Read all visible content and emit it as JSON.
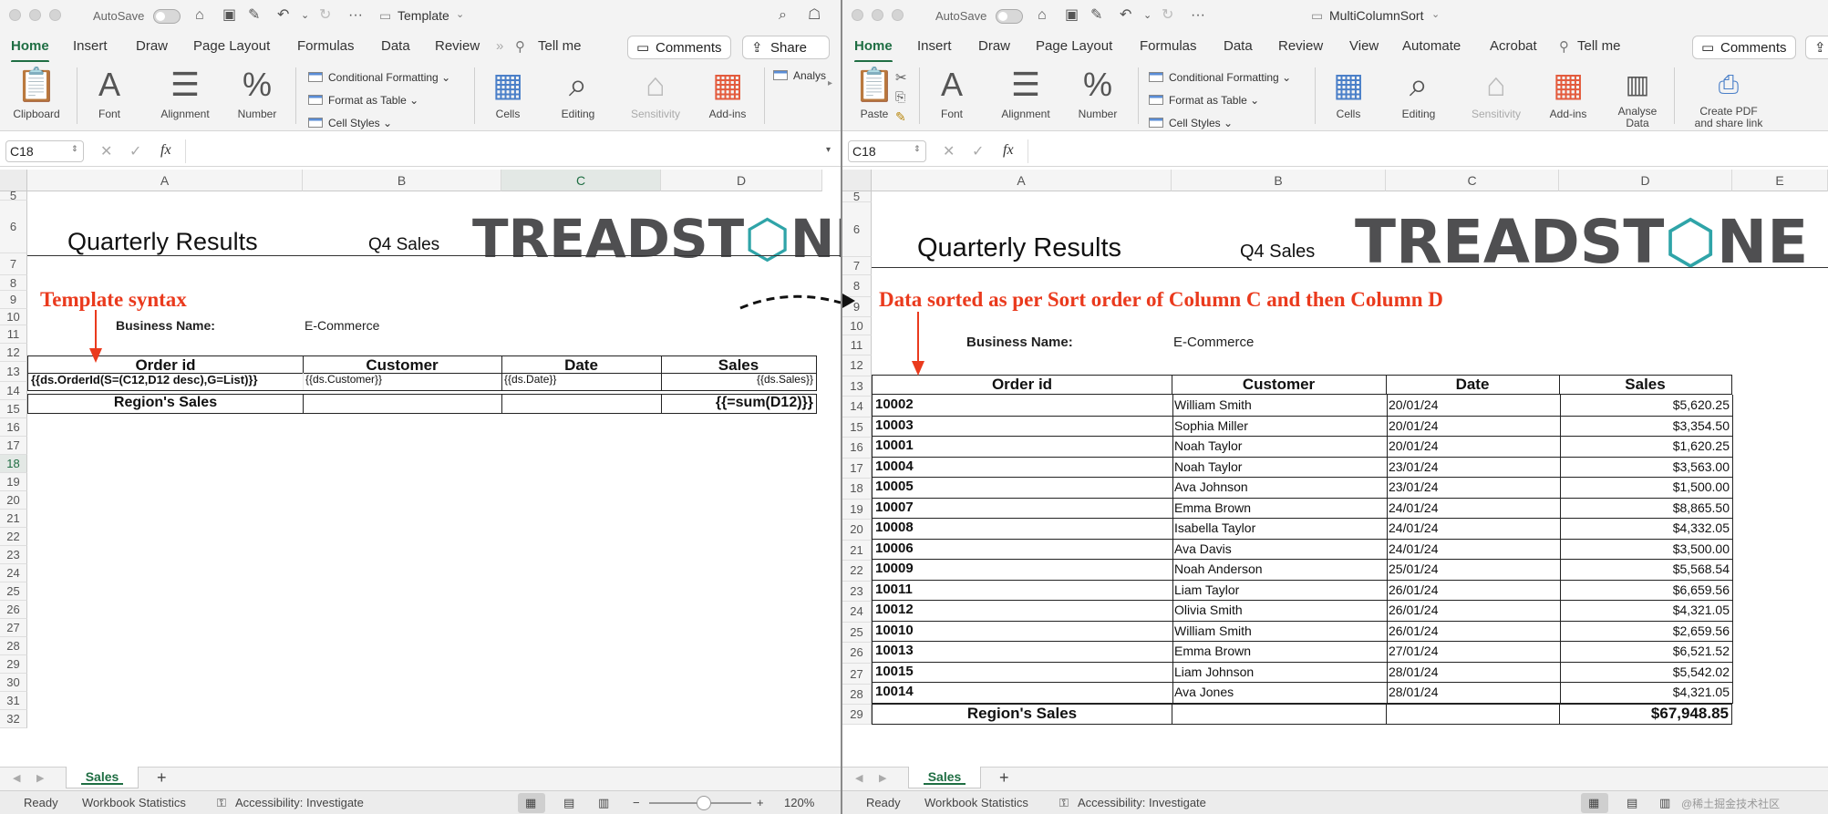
{
  "titlebar": {
    "autosave": "AutoSave",
    "left_title": "Template",
    "right_title": "MultiColumnSort"
  },
  "tabs": {
    "home": "Home",
    "insert": "Insert",
    "draw": "Draw",
    "page_layout": "Page Layout",
    "formulas": "Formulas",
    "data": "Data",
    "review": "Review",
    "view": "View",
    "automate": "Automate",
    "acrobat": "Acrobat",
    "tell_me": "Tell me",
    "comments": "Comments",
    "share": "Share"
  },
  "ribbon": {
    "clipboard": "Clipboard",
    "paste": "Paste",
    "font": "Font",
    "alignment": "Alignment",
    "number": "Number",
    "conditional_formatting": "Conditional Formatting",
    "format_as_table": "Format as Table",
    "cell_styles": "Cell Styles",
    "cells": "Cells",
    "editing": "Editing",
    "sensitivity": "Sensitivity",
    "add_ins": "Add-ins",
    "analyse_data_1": "Analyse",
    "analyse_data_2": "Data",
    "analyse_trunc": "Analys",
    "create_pdf_1": "Create PDF",
    "create_pdf_2": "and share link"
  },
  "formula_bar": {
    "left_name": "C18",
    "right_name": "C18",
    "fx": "fx"
  },
  "columns": {
    "a": "A",
    "b": "B",
    "c": "C",
    "d": "D",
    "e": "E"
  },
  "left_sheet": {
    "row_numbers": [
      "5",
      "6",
      "7",
      "8",
      "9",
      "10",
      "11",
      "12",
      "13",
      "14",
      "15",
      "16",
      "17",
      "18",
      "19",
      "20",
      "21",
      "22",
      "23",
      "24",
      "25",
      "26",
      "27",
      "28",
      "29",
      "30",
      "31",
      "32"
    ],
    "title": "Quarterly Results",
    "subtitle": "Q4 Sales",
    "logo_text_1": "TREADST",
    "logo_text_2": "NE",
    "annotation": "Template syntax",
    "business_label": "Business Name:",
    "business_value": "E-Commerce",
    "headers": [
      "Order id",
      "Customer",
      "Date",
      "Sales"
    ],
    "template_row": [
      "{{ds.OrderId(S=(C12,D12 desc),G=List)}}",
      "{{ds.Customer}}",
      "{{ds.Date}}",
      "{{ds.Sales}}"
    ],
    "total_label": "Region's Sales",
    "total_formula": "{{=sum(D12)}}"
  },
  "right_sheet": {
    "row_numbers": [
      "5",
      "6",
      "7",
      "8",
      "9",
      "10",
      "11",
      "12",
      "13",
      "14",
      "15",
      "16",
      "17",
      "18",
      "19",
      "20",
      "21",
      "22",
      "23",
      "24",
      "25",
      "26",
      "27",
      "28",
      "29"
    ],
    "title": "Quarterly Results",
    "subtitle": "Q4 Sales",
    "logo_text_1": "TREADST",
    "logo_text_2": "NE",
    "annotation": "Data sorted as per Sort order of Column C and then Column D",
    "business_label": "Business Name:",
    "business_value": "E-Commerce",
    "headers": [
      "Order id",
      "Customer",
      "Date",
      "Sales"
    ],
    "rows": [
      [
        "10002",
        "William Smith",
        "20/01/24",
        "$5,620.25"
      ],
      [
        "10003",
        "Sophia Miller",
        "20/01/24",
        "$3,354.50"
      ],
      [
        "10001",
        "Noah Taylor",
        "20/01/24",
        "$1,620.25"
      ],
      [
        "10004",
        "Noah Taylor",
        "23/01/24",
        "$3,563.00"
      ],
      [
        "10005",
        "Ava Johnson",
        "23/01/24",
        "$1,500.00"
      ],
      [
        "10007",
        "Emma Brown",
        "24/01/24",
        "$8,865.50"
      ],
      [
        "10008",
        "Isabella Taylor",
        "24/01/24",
        "$4,332.05"
      ],
      [
        "10006",
        "Ava Davis",
        "24/01/24",
        "$3,500.00"
      ],
      [
        "10009",
        "Noah Anderson",
        "25/01/24",
        "$5,568.54"
      ],
      [
        "10011",
        "Liam Taylor",
        "26/01/24",
        "$6,659.56"
      ],
      [
        "10012",
        "Olivia Smith",
        "26/01/24",
        "$4,321.05"
      ],
      [
        "10010",
        "William Smith",
        "26/01/24",
        "$2,659.56"
      ],
      [
        "10013",
        "Emma Brown",
        "27/01/24",
        "$6,521.52"
      ],
      [
        "10015",
        "Liam Johnson",
        "28/01/24",
        "$5,542.02"
      ],
      [
        "10014",
        "Ava Jones",
        "28/01/24",
        "$4,321.05"
      ]
    ],
    "total_label": "Region's Sales",
    "total_value": "$67,948.85"
  },
  "sheet_tab": "Sales",
  "add_sheet": "+",
  "status": {
    "ready": "Ready",
    "workbook_stats": "Workbook Statistics",
    "accessibility": "Accessibility: Investigate",
    "zoom": "120%",
    "watermark": "@稀土掘金技术社区"
  },
  "colors": {
    "accent": "#1f6e43",
    "annotation": "#ea3a1d",
    "logo_gray": "#4f4f51",
    "logo_teal": "#2fa4a8"
  }
}
